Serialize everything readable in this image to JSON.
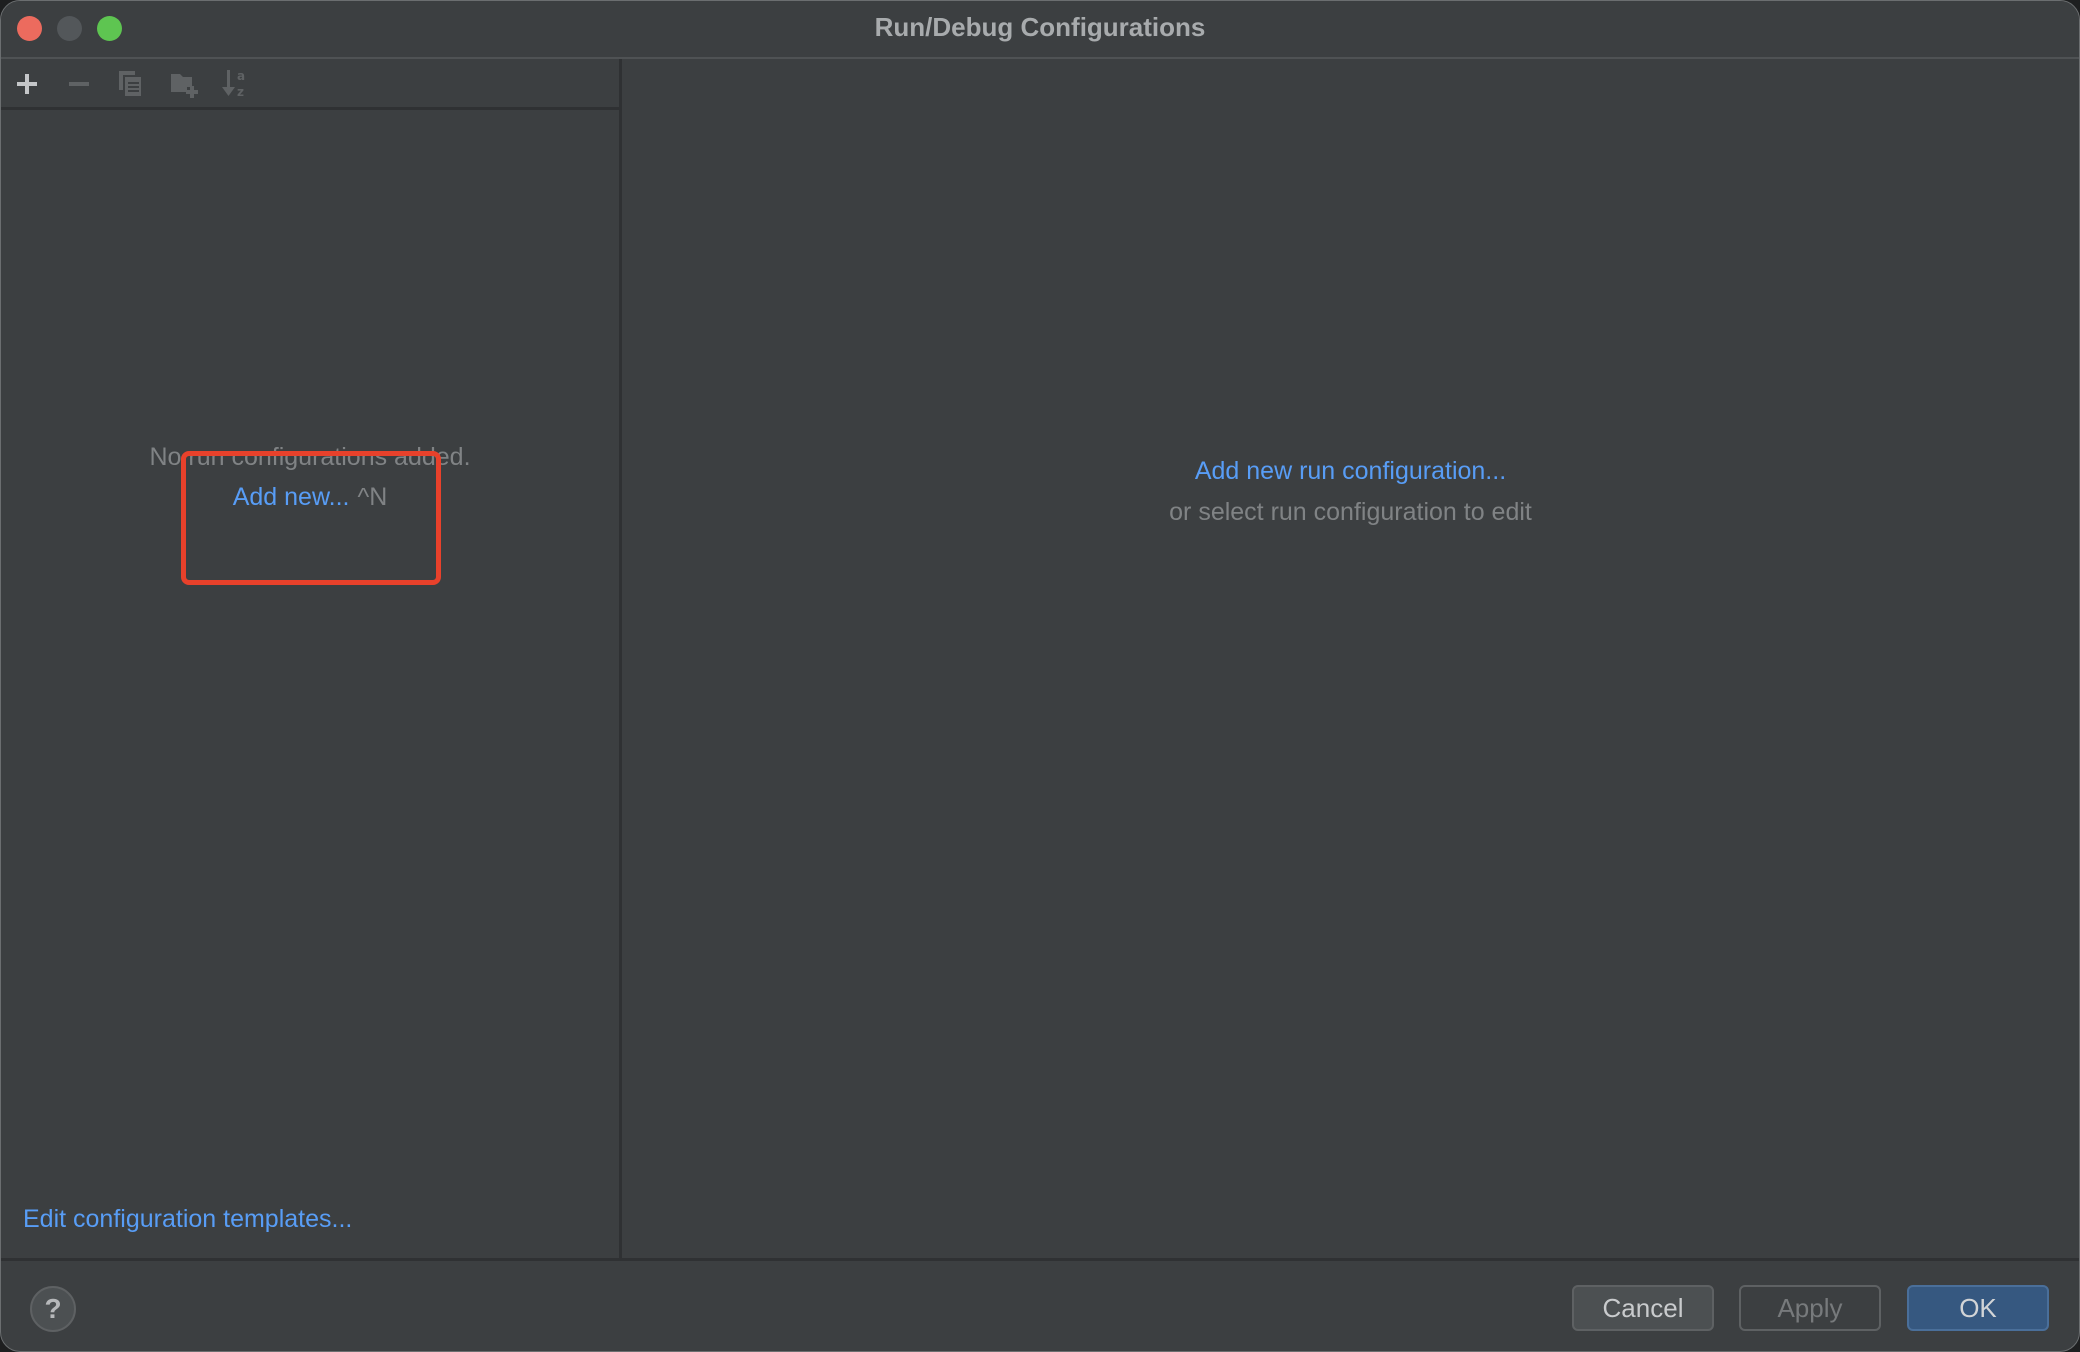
{
  "window": {
    "title": "Run/Debug Configurations",
    "traffic_lights": [
      "close",
      "minimize",
      "maximize"
    ]
  },
  "toolbar": {
    "icons": [
      {
        "name": "add-icon",
        "label": "Add",
        "enabled": true
      },
      {
        "name": "remove-icon",
        "label": "Remove",
        "enabled": false
      },
      {
        "name": "copy-icon",
        "label": "Copy",
        "enabled": false
      },
      {
        "name": "new-folder-icon",
        "label": "Create new folder",
        "enabled": false
      },
      {
        "name": "sort-alphabetically-icon",
        "label": "Sort alphabetically",
        "enabled": false
      }
    ]
  },
  "left_panel": {
    "empty_message": "No run configurations added.",
    "add_new_label": "Add new...",
    "add_new_shortcut": "^N",
    "templates_link": "Edit configuration templates..."
  },
  "right_panel": {
    "add_link": "Add new run configuration...",
    "hint": "or select run configuration to edit"
  },
  "footer": {
    "help_label": "?",
    "cancel_label": "Cancel",
    "apply_label": "Apply",
    "ok_label": "OK"
  },
  "colors": {
    "background": "#3c3f41",
    "link": "#589df6",
    "muted_text": "#808385",
    "primary_button": "#365880",
    "highlight_annotation": "#e8412b"
  }
}
